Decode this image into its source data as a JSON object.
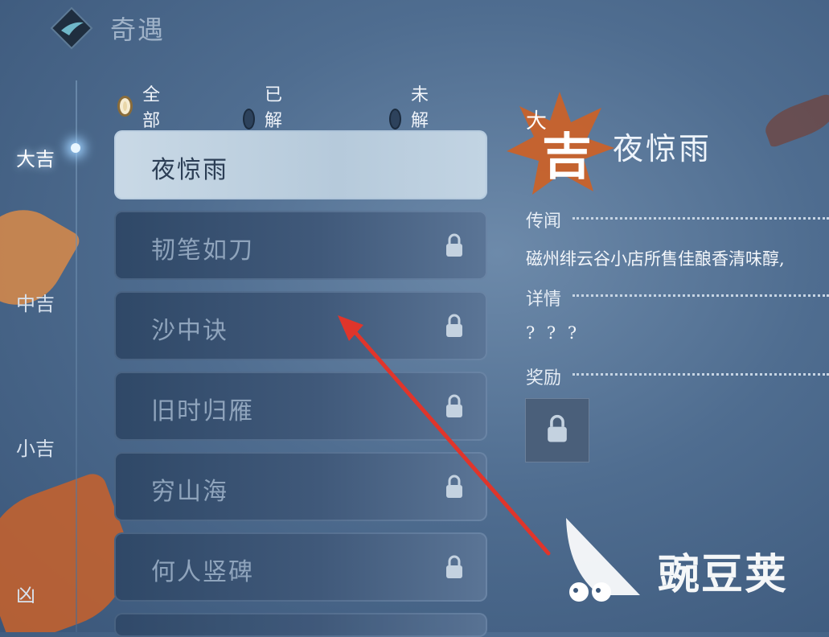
{
  "header": {
    "title": "奇遇",
    "logo_icon": "diamond-logo-icon"
  },
  "categories": [
    {
      "label": "大吉",
      "active": true
    },
    {
      "label": "中吉",
      "active": false
    },
    {
      "label": "小吉",
      "active": false
    },
    {
      "label": "凶",
      "active": false
    }
  ],
  "filters": [
    {
      "label": "全部",
      "selected": true
    },
    {
      "label": "已解锁",
      "selected": false
    },
    {
      "label": "未解锁",
      "selected": false
    }
  ],
  "encounters": [
    {
      "name": "夜惊雨",
      "selected": true,
      "locked": false
    },
    {
      "name": "韧笔如刀",
      "selected": false,
      "locked": true
    },
    {
      "name": "沙中诀",
      "selected": false,
      "locked": true
    },
    {
      "name": "旧时归雁",
      "selected": false,
      "locked": true
    },
    {
      "name": "穷山海",
      "selected": false,
      "locked": true
    },
    {
      "name": "何人竖碑",
      "selected": false,
      "locked": true
    }
  ],
  "detail": {
    "badge_small": "大",
    "badge_big": "吉",
    "title": "夜惊雨",
    "rumor_label": "传闻",
    "rumor_text": "磁州绯云谷小店所售佳酿香清味醇,",
    "details_label": "详情",
    "details_text": "? ? ?",
    "reward_label": "奖励",
    "reward_icon": "lock-icon"
  },
  "watermark": {
    "text": "豌豆荚"
  },
  "colors": {
    "accent_orange": "#c9622a",
    "selected_item": "#c9d9e6",
    "arrow_red": "#e0352b"
  }
}
